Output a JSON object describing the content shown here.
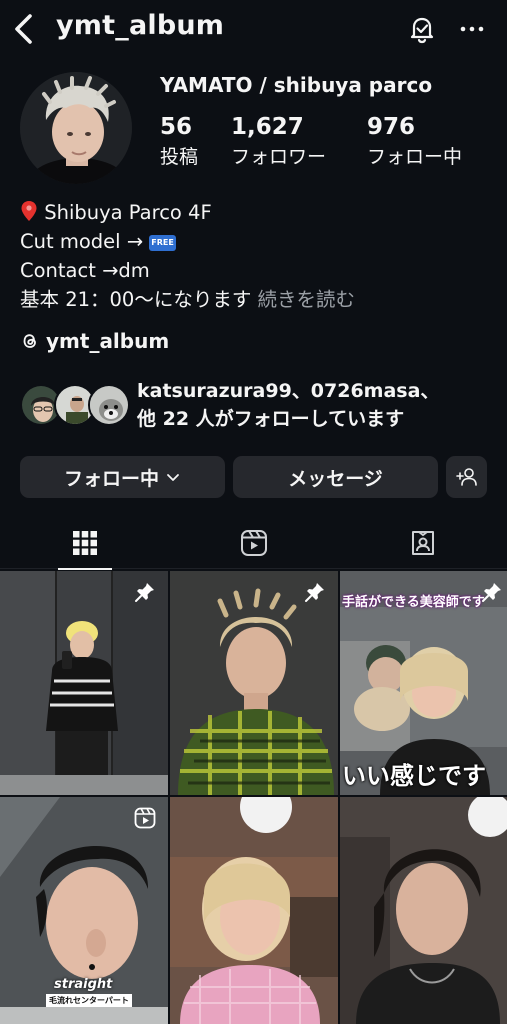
{
  "header": {
    "username": "ymt_album"
  },
  "profile": {
    "display_name": "YAMATO / shibuya parco",
    "stats": [
      {
        "value": "56",
        "label": "投稿"
      },
      {
        "value": "1,627",
        "label": "フォロワー"
      },
      {
        "value": "976",
        "label": "フォロー中"
      }
    ],
    "bio": {
      "location": "Shibuya Parco 4F",
      "cut_model": "Cut model →",
      "free_badge": "FREE",
      "contact": "Contact →dm",
      "hours": "基本 21：00〜になります",
      "more_label": "続きを読む"
    },
    "threads_handle": "ymt_album",
    "followed_by": {
      "line1": "katsurazura99、0726masa、",
      "line2": "他 22 人がフォローしています"
    }
  },
  "actions": {
    "following_label": "フォロー中",
    "message_label": "メッセージ"
  },
  "tabs": [
    {
      "name": "posts-grid",
      "icon": "grid-icon",
      "active": true
    },
    {
      "name": "reels",
      "icon": "reels-icon",
      "active": false
    },
    {
      "name": "tagged",
      "icon": "tagged-icon",
      "active": false
    }
  ],
  "posts": [
    {
      "badge": "pin-icon"
    },
    {
      "badge": "pin-icon"
    },
    {
      "badge": "pin-icon",
      "caption_top": "手話ができる美容師です",
      "caption_bottom": "いい感じです"
    },
    {
      "badge": "reel-icon",
      "caption_style": "straight",
      "caption_sub": "毛流れセンターパート"
    },
    {
      "badge": ""
    },
    {
      "badge": ""
    }
  ],
  "colors": {
    "background": "#0c0f14",
    "button": "#26282d",
    "muted_text": "#9ba0a6"
  }
}
